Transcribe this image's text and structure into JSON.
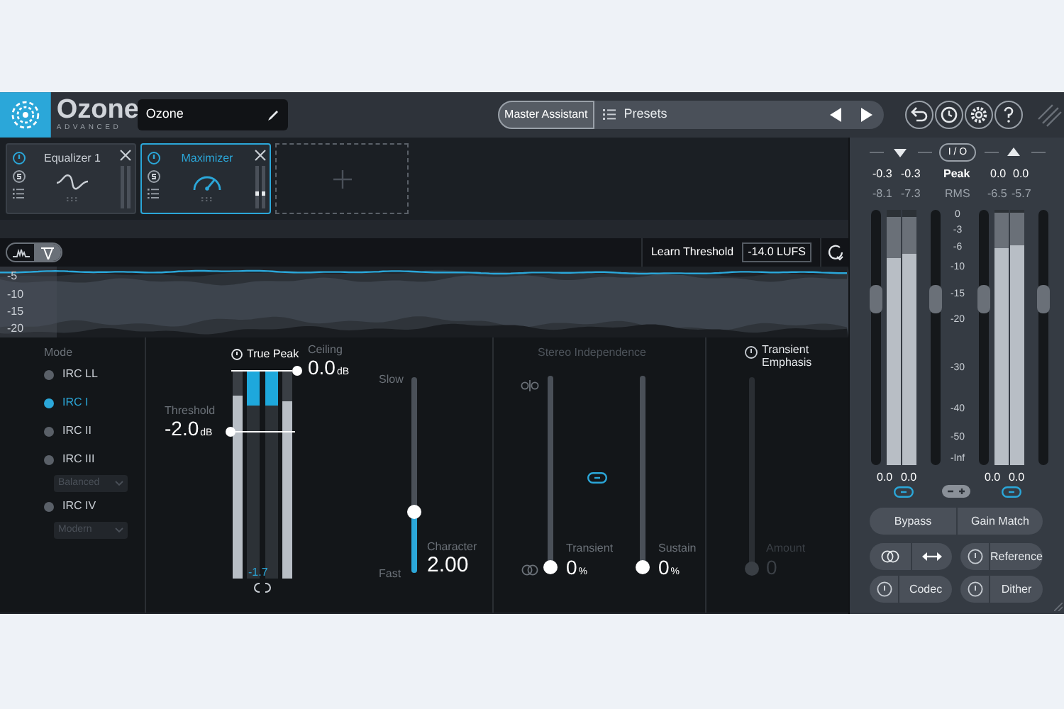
{
  "header": {
    "logo_title": "Ozone",
    "logo_subtitle": "ADVANCED",
    "preset_name": "Ozone",
    "assistant_button": "Master Assistant",
    "presets_label": "Presets"
  },
  "modules": [
    {
      "name": "Equalizer 1",
      "kind": "eq",
      "selected": false
    },
    {
      "name": "Maximizer",
      "kind": "maximizer",
      "selected": true
    }
  ],
  "waveform": {
    "scale": [
      "-5",
      "-10",
      "-15",
      "-20"
    ],
    "learn_label": "Learn Threshold",
    "target": "-14.0 LUFS"
  },
  "mode": {
    "title": "Mode",
    "options": [
      {
        "label": "IRC LL",
        "selected": false
      },
      {
        "label": "IRC I",
        "selected": true
      },
      {
        "label": "IRC II",
        "selected": false
      },
      {
        "label": "IRC III",
        "selected": false,
        "dropdown": "Balanced"
      },
      {
        "label": "IRC IV",
        "selected": false,
        "dropdown": "Modern"
      }
    ]
  },
  "maximizer": {
    "true_peak_label": "True Peak",
    "ceiling": {
      "label": "Ceiling",
      "value": "0.0",
      "unit": "dB"
    },
    "threshold": {
      "label": "Threshold",
      "value": "-2.0",
      "unit": "dB"
    },
    "gain_reduction": "-1.7",
    "meters": [
      {
        "kind": "input",
        "level": 0.88
      },
      {
        "kind": "reduction",
        "level": 0.17
      },
      {
        "kind": "reduction",
        "level": 0.17
      },
      {
        "kind": "input",
        "level": 0.85
      }
    ]
  },
  "character": {
    "slow_label": "Slow",
    "fast_label": "Fast",
    "label": "Character",
    "value": "2.00",
    "level": 0.3
  },
  "stereo": {
    "title": "Stereo Independence",
    "sliders": [
      {
        "label": "Transient",
        "value": "0",
        "unit": "%",
        "level": 0
      },
      {
        "label": "Sustain",
        "value": "0",
        "unit": "%",
        "level": 0
      }
    ]
  },
  "transient_emphasis": {
    "title": "Transient Emphasis",
    "amount_label": "Amount",
    "amount_value": "0",
    "level": 0,
    "disabled": true
  },
  "io": {
    "io_label": "I / O",
    "peak_label": "Peak",
    "rms_label": "RMS",
    "scale": [
      "0",
      "-3",
      "-6",
      "-10",
      "-15",
      "-20",
      "-30",
      "-40",
      "-50",
      "-Inf"
    ],
    "input": {
      "peak": [
        "-0.3",
        "-0.3"
      ],
      "rms": [
        "-8.1",
        "-7.3"
      ],
      "gain": [
        "0.0",
        "0.0"
      ],
      "faders": [
        {
          "level": 0.67
        },
        {
          "level": 0.67
        }
      ],
      "channels": [
        {
          "layers": [
            {
              "level": 0.97
            },
            {
              "level": 0.81
            }
          ]
        },
        {
          "layers": [
            {
              "level": 0.97
            },
            {
              "level": 0.83
            }
          ]
        }
      ]
    },
    "output": {
      "peak": [
        "0.0",
        "0.0"
      ],
      "rms": [
        "-6.5",
        "-5.7"
      ],
      "gain": [
        "0.0",
        "0.0"
      ],
      "faders": [
        {
          "level": 0.67
        },
        {
          "level": 0.67
        }
      ],
      "channels": [
        {
          "layers": [
            {
              "level": 0.99
            },
            {
              "level": 0.85
            }
          ]
        },
        {
          "layers": [
            {
              "level": 0.99
            },
            {
              "level": 0.86
            }
          ]
        }
      ]
    }
  },
  "buttons": {
    "bypass": "Bypass",
    "gain_match": "Gain Match",
    "reference": "Reference",
    "codec": "Codec",
    "dither": "Dither"
  }
}
